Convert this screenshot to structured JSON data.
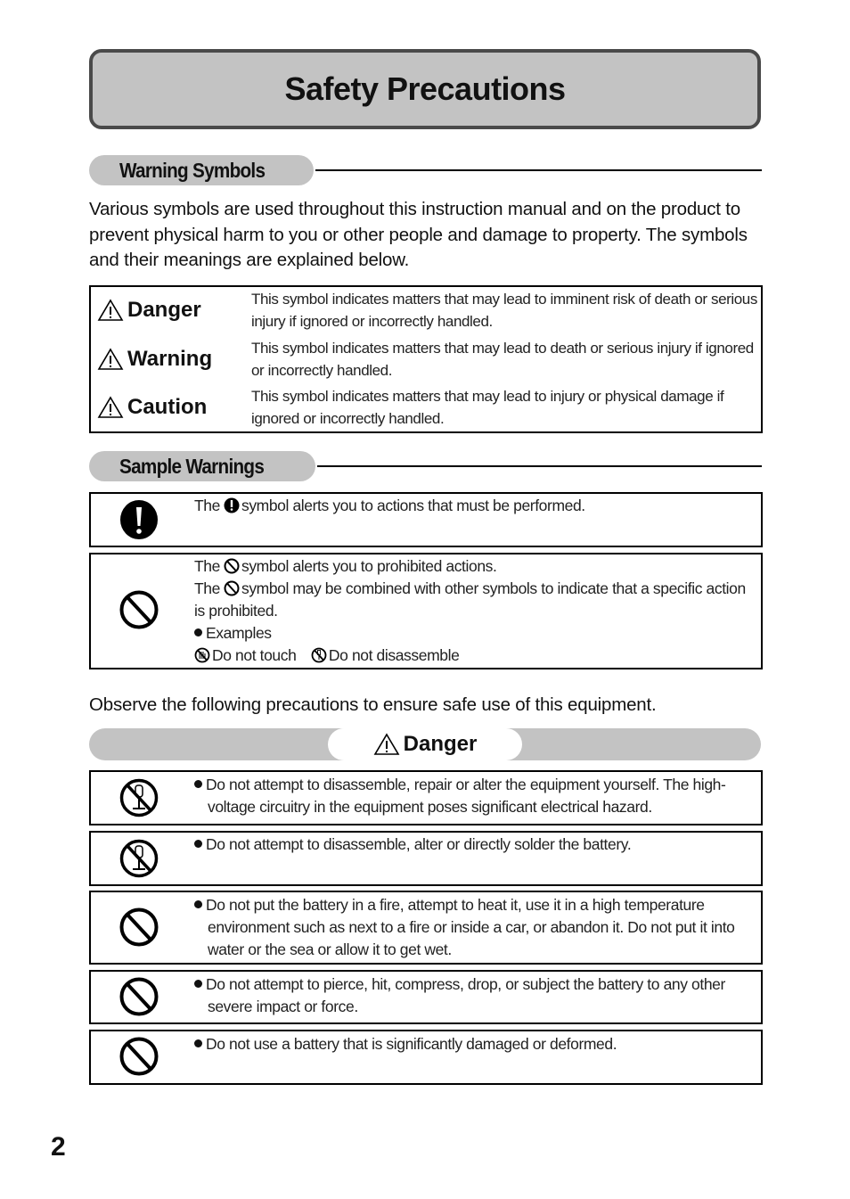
{
  "page": {
    "title": "Safety Precautions",
    "page_number": "2"
  },
  "warning_symbols": {
    "heading": "Warning Symbols",
    "intro": "Various symbols are used throughout this instruction manual and on the product to prevent physical harm to you or other people and damage to property. The symbols and their meanings are explained below.",
    "rows": [
      {
        "icon": "warning-triangle-icon",
        "label": "Danger",
        "description": "This symbol indicates matters that may lead to imminent risk of death or serious injury if ignored or incorrectly handled."
      },
      {
        "icon": "warning-triangle-icon",
        "label": "Warning",
        "description": "This symbol indicates matters that may lead to death or serious injury if ignored or incorrectly handled."
      },
      {
        "icon": "warning-triangle-icon",
        "label": "Caution",
        "description": "This symbol indicates matters that may lead to injury or physical damage if ignored or incorrectly handled."
      }
    ]
  },
  "sample_warnings": {
    "heading": "Sample Warnings",
    "mandatory": {
      "icon": "mandatory-exclamation-icon",
      "text_before": "The",
      "text_after": "symbol alerts you to actions that must be performed."
    },
    "prohibited": {
      "icon": "prohibited-icon",
      "line1_before": "The",
      "line1_after": "symbol alerts you to prohibited actions.",
      "line2_before": "The",
      "line2_after": "symbol may be combined with other symbols to indicate that a specific action is prohibited.",
      "examples_label": "Examples",
      "examples": [
        {
          "icon": "do-not-touch-icon",
          "label": "Do not touch"
        },
        {
          "icon": "do-not-disassemble-icon",
          "label": "Do not disassemble"
        }
      ]
    }
  },
  "observe_text": "Observe the following precautions to ensure safe use of this equipment.",
  "danger_section": {
    "icon": "warning-triangle-icon",
    "heading": "Danger",
    "items": [
      {
        "icon": "do-not-disassemble-icon",
        "text": "Do not attempt to disassemble, repair or alter the equipment yourself. The high-voltage circuitry in the equipment poses significant electrical hazard."
      },
      {
        "icon": "do-not-disassemble-icon",
        "text": "Do not attempt to disassemble, alter or directly solder the battery."
      },
      {
        "icon": "prohibited-icon",
        "text": "Do not put the battery in a fire, attempt to heat it, use it in a high temperature environment such as next to a fire or inside a car, or abandon it. Do not put it into water or the sea or allow it to get wet."
      },
      {
        "icon": "prohibited-icon",
        "text": "Do not attempt to pierce, hit, compress, drop, or subject the battery to any other severe impact or force."
      },
      {
        "icon": "prohibited-icon",
        "text": "Do not use a battery that is significantly damaged or deformed."
      }
    ]
  }
}
